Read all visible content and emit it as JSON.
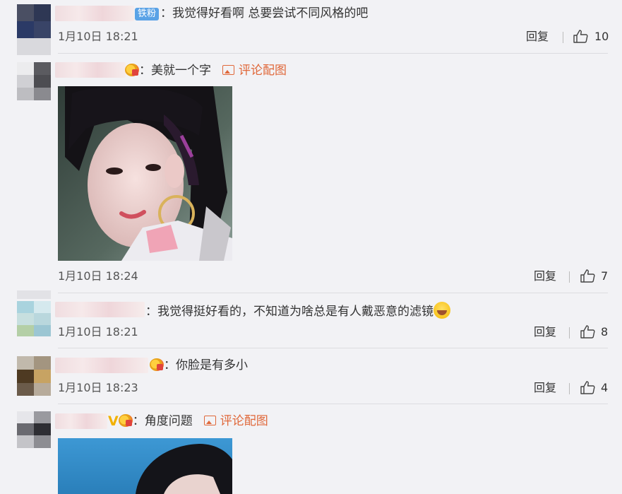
{
  "comments": [
    {
      "badge": "铁粉",
      "text": "：我觉得好看啊 总要尝试不同风格的吧",
      "time": "1月10日 18:21",
      "reply": "回复",
      "likes": "10"
    },
    {
      "text": "：美就一个字",
      "pic_link": "评论配图",
      "time": "1月10日 18:24",
      "reply": "回复",
      "likes": "7"
    },
    {
      "text": "：我觉得挺好看的，不知道为啥总是有人戴恶意的滤镜",
      "time": "1月10日 18:21",
      "reply": "回复",
      "likes": "8"
    },
    {
      "text": "：你脸是有多小",
      "time": "1月10日 18:23",
      "reply": "回复",
      "likes": "4"
    },
    {
      "text": "：角度问题",
      "pic_link": "评论配图",
      "v_mark": "V"
    }
  ],
  "icons": {
    "like": "thumbs-up-icon",
    "picture": "image-icon",
    "member": "vip-crown-icon",
    "verified": "verified-v-icon",
    "emoji": "laughing-emoji-icon"
  },
  "colors": {
    "background": "#f2f2f5",
    "link": "#e0683a",
    "fan_badge": "#5aa2e6"
  }
}
